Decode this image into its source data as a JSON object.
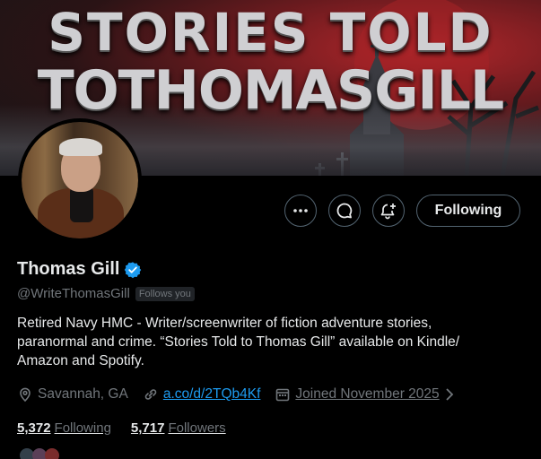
{
  "banner": {
    "line1": "STORIES TOLD",
    "line2": "TOTHOMASGILL"
  },
  "profile": {
    "name": "Thomas Gill",
    "handle": "@WriteThomasGill",
    "follows_you": "Follows you",
    "verified_icon": "verified-badge-icon",
    "bio_lines": [
      "Retired Navy HMC - Writer/screenwriter of fiction adventure stories,",
      "paranormal and crime. “Stories Told to Thomas Gill” available on Kindle/",
      "Amazon and Spotify."
    ],
    "location": "Savannah, GA",
    "link": "a.co/d/2TQb4Kf",
    "joined": "Joined November 2025"
  },
  "actions": {
    "following_label": "Following",
    "more_icon": "more-icon",
    "message_icon": "message-icon",
    "notify_icon": "notify-bell-plus-icon"
  },
  "stats": {
    "following_count": "5,372",
    "following_label": "Following",
    "followers_count": "5,717",
    "followers_label": "Followers"
  },
  "colors": {
    "background": "#000000",
    "text": "#e7e9ea",
    "secondary": "#71767b",
    "link": "#1d9bf0",
    "verified": "#1d9bf0",
    "border": "#536471"
  }
}
